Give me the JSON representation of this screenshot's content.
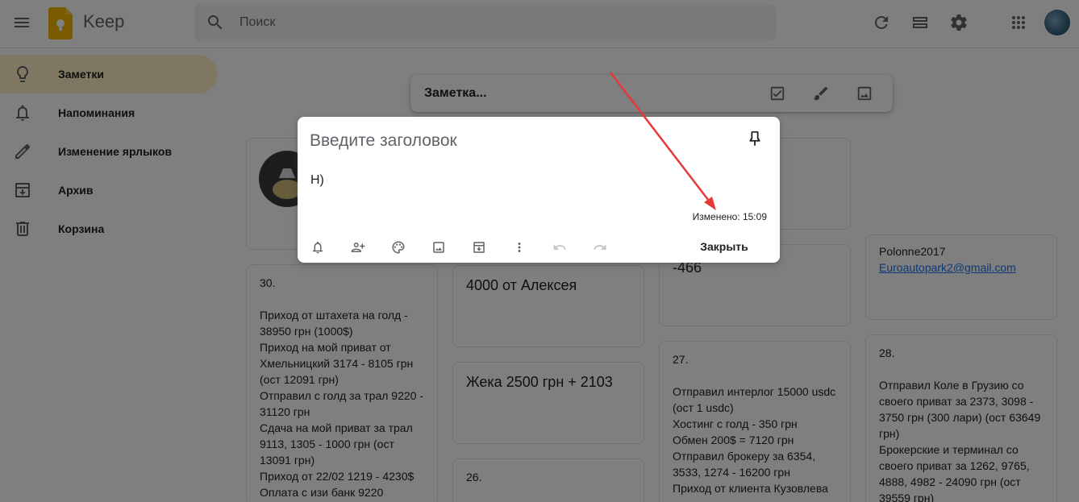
{
  "app": {
    "title": "Keep"
  },
  "search": {
    "placeholder": "Поиск"
  },
  "sidebar": {
    "items": [
      {
        "label": "Заметки",
        "icon": "bulb-icon"
      },
      {
        "label": "Напоминания",
        "icon": "bell-icon"
      },
      {
        "label": "Изменение ярлыков",
        "icon": "pencil-icon"
      },
      {
        "label": "Архив",
        "icon": "archive-icon"
      },
      {
        "label": "Корзина",
        "icon": "trash-icon"
      }
    ]
  },
  "take_note": {
    "placeholder": "Заметка..."
  },
  "cards": {
    "c30": {
      "title": "30.",
      "body": "Приход от штахета на голд - 38950 грн (1000$)\nПриход на мой приват от Хмельницкий 3174 - 8105 грн (ост 12091 грн)\nОтправил с голд за трал 9220 - 31120 грн\nСдача на мой приват за трал 9113, 1305 - 1000 грн (ост 13091 грн)\nПриход от 22/02 1219 - 4230$\nОплата с изи банк 9220"
    },
    "c4000": {
      "title": "4000 от Алексея"
    },
    "c466": {
      "title": "-466"
    },
    "cpol": {
      "title": "Polonne2017",
      "link": "Euroautopark2@gmail.com"
    },
    "czheka": {
      "title": "Жека 2500 грн + 2103"
    },
    "c26": {
      "title": "26."
    },
    "c27": {
      "title": "27.",
      "body": "Отправил интерлог 15000 usdc (ост 1 usdc)\nХостинг с голд - 350 грн\nОбмен 200$ = 7120 грн\nОтправил брокеру за 6354, 3533, 1274 - 16200 грн\nПриход от клиента Кузовлева"
    },
    "c28": {
      "title": "28.",
      "body": "Отправил Коле в Грузию со своего приват за 2373, 3098 - 3750 грн (300 лари) (ост 63649 грн)\nБрокерские и терминал со своего приват за 1262, 9765, 4888, 4982 - 24090 грн (ост 39559 грн)"
    }
  },
  "dialog": {
    "title_placeholder": "Введите заголовок",
    "body": "Н)",
    "edited": "Изменено: 15:09",
    "close_label": "Закрыть"
  },
  "colors": {
    "active_nav": "#feefc3",
    "link": "#1a73e8",
    "annotation_arrow": "#e53935"
  }
}
